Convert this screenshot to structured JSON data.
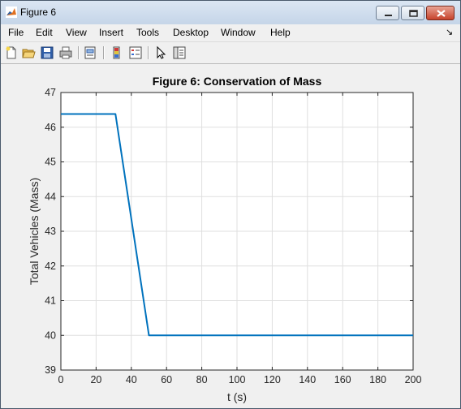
{
  "window": {
    "title": "Figure 6"
  },
  "menu": [
    "File",
    "Edit",
    "View",
    "Insert",
    "Tools",
    "Desktop",
    "Window",
    "Help"
  ],
  "toolbar_icons": [
    "new-figure-icon",
    "open-file-icon",
    "save-icon",
    "print-icon",
    "link-plot-icon",
    "colorbar-icon",
    "legend-icon",
    "edit-plot-icon",
    "property-inspector-icon"
  ],
  "chart_data": {
    "type": "line",
    "title": "Figure 6: Conservation of Mass",
    "xlabel": "t (s)",
    "ylabel": "Total Vehicles (Mass)",
    "xlim": [
      0,
      200
    ],
    "ylim": [
      39,
      47
    ],
    "xticks": [
      0,
      20,
      40,
      60,
      80,
      100,
      120,
      140,
      160,
      180,
      200
    ],
    "yticks": [
      39,
      40,
      41,
      42,
      43,
      44,
      45,
      46,
      47
    ],
    "grid": true,
    "color": "#0072bd",
    "series": [
      {
        "x": [
          0,
          31,
          50,
          200
        ],
        "y": [
          46.38,
          46.38,
          40.0,
          40.0
        ]
      }
    ]
  }
}
